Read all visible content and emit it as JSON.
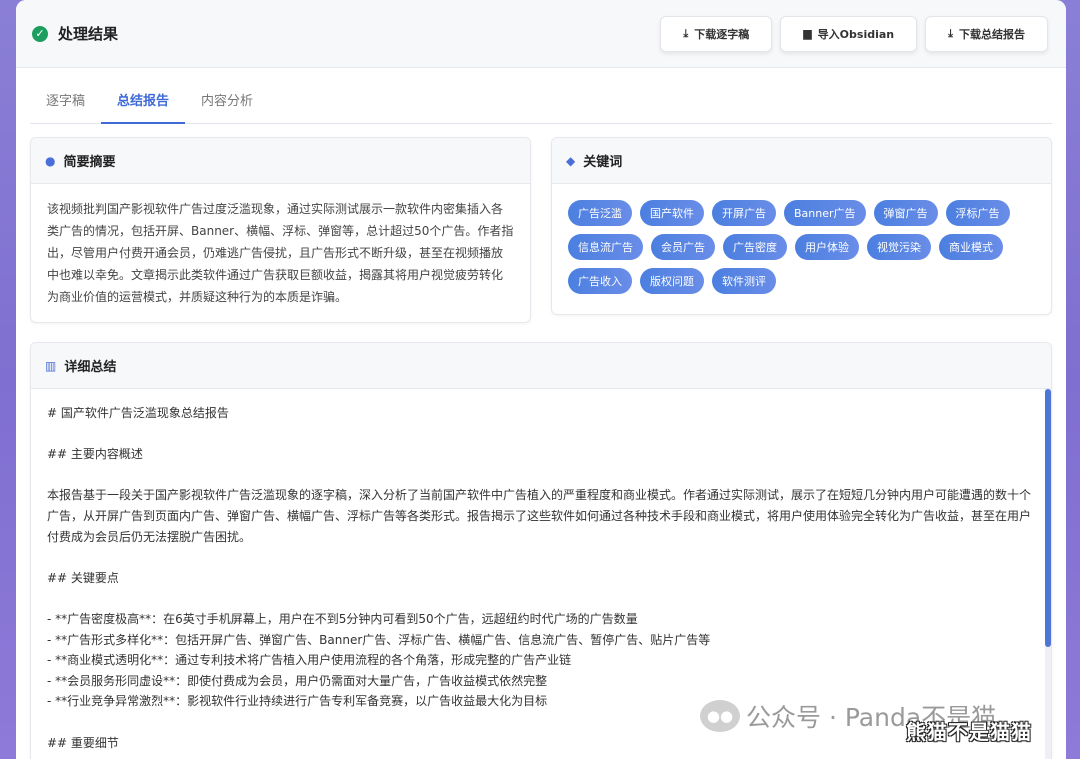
{
  "header": {
    "title": "处理结果",
    "buttons": [
      {
        "label": "下载逐字稿",
        "icon": "download-icon"
      },
      {
        "label": "导入Obsidian",
        "icon": "book-icon"
      },
      {
        "label": "下载总结报告",
        "icon": "download-icon"
      }
    ]
  },
  "tabs": [
    "逐字稿",
    "总结报告",
    "内容分析"
  ],
  "active_tab": "总结报告",
  "summary": {
    "title": "简要摘要",
    "icon": "lightbulb-icon",
    "text": "该视频批判国产影视软件广告过度泛滥现象，通过实际测试展示一款软件内密集插入各类广告的情况，包括开屏、Banner、横幅、浮标、弹窗等，总计超过50个广告。作者指出，尽管用户付费开通会员，仍难逃广告侵扰，且广告形式不断升级，甚至在视频播放中也难以幸免。文章揭示此类软件通过广告获取巨额收益，揭露其将用户视觉疲劳转化为商业价值的运营模式，并质疑这种行为的本质是诈骗。"
  },
  "keywords": {
    "title": "关键词",
    "icon": "tag-icon",
    "items": [
      "广告泛滥",
      "国产软件",
      "开屏广告",
      "Banner广告",
      "弹窗广告",
      "浮标广告",
      "信息流广告",
      "会员广告",
      "广告密度",
      "用户体验",
      "视觉污染",
      "商业模式",
      "广告收入",
      "版权问题",
      "软件测评"
    ]
  },
  "detail": {
    "title": "详细总结",
    "icon": "book-open-icon",
    "lines": [
      "# 国产软件广告泛滥现象总结报告",
      "",
      "## 主要内容概述",
      "",
      "本报告基于一段关于国产影视软件广告泛滥现象的逐字稿，深入分析了当前国产软件中广告植入的严重程度和商业模式。作者通过实际测试，展示了在短短几分钟内用户可能遭遇的数十个广告，从开屏广告到页面内广告、弹窗广告、横幅广告、浮标广告等各类形式。报告揭示了这些软件如何通过各种技术手段和商业模式，将用户使用体验完全转化为广告收益，甚至在用户付费成为会员后仍无法摆脱广告困扰。",
      "",
      "## 关键要点",
      "",
      "- **广告密度极高**：在6英寸手机屏幕上，用户在不到5分钟内可看到50个广告，远超纽约时代广场的广告数量",
      "- **广告形式多样化**：包括开屏广告、弹窗广告、Banner广告、浮标广告、横幅广告、信息流广告、暂停广告、贴片广告等",
      "- **商业模式透明化**：通过专利技术将广告植入用户使用流程的各个角落，形成完整的广告产业链",
      "- **会员服务形同虚设**：即使付费成为会员，用户仍需面对大量广告，广告收益模式依然完整",
      "- **行业竞争异常激烈**：影视软件行业持续进行广告专利军备竞赛，以广告收益最大化为目标",
      "",
      "## 重要细节"
    ]
  },
  "watermark": {
    "text": "公众号 · Panda不是猫",
    "overlay": "熊猫不是猫猫"
  }
}
